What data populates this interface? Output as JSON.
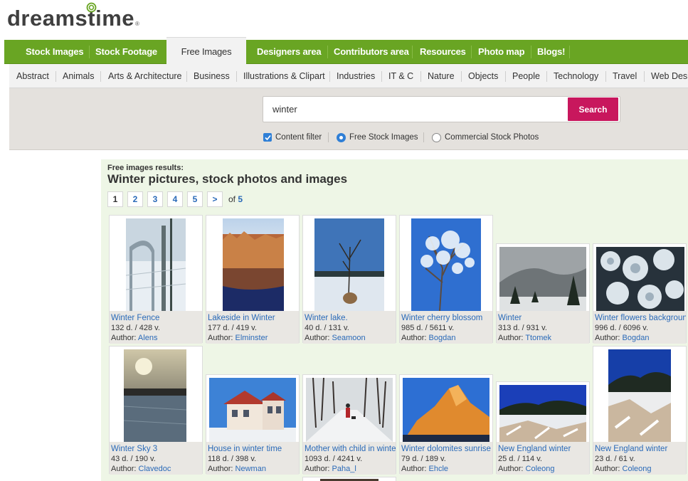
{
  "logo": {
    "text": "dreamstime",
    "reg": "®"
  },
  "main_nav": [
    {
      "label": "Stock Images"
    },
    {
      "label": "Stock Footage"
    },
    {
      "label": "Free Images",
      "active": true
    },
    {
      "label": "Designers area"
    },
    {
      "label": "Contributors area"
    },
    {
      "label": "Resources"
    },
    {
      "label": "Photo map"
    },
    {
      "label": "Blogs!"
    }
  ],
  "categories": [
    "Abstract",
    "Animals",
    "Arts & Architecture",
    "Business",
    "Illustrations & Clipart",
    "Industries",
    "IT & C",
    "Nature",
    "Objects",
    "People",
    "Technology",
    "Travel",
    "Web Design"
  ],
  "search": {
    "value": "winter",
    "button": "Search",
    "content_filter": "Content filter",
    "free_label": "Free Stock Images",
    "commercial_label": "Commercial Stock Photos"
  },
  "results": {
    "pre": "Free images results:",
    "title": "Winter pictures, stock photos and images",
    "pages": [
      "1",
      "2",
      "3",
      "4",
      "5",
      ">"
    ],
    "of_label": "of",
    "total_pages": "5"
  },
  "author_label": "Author:",
  "colors": {
    "brand_green": "#69a523",
    "search_button": "#c8175d",
    "link_blue": "#2a6ab8",
    "results_bg": "#eef6e6"
  },
  "images": [
    {
      "title": "Winter Fence",
      "stats": "132 d. / 428 v.",
      "author": "Alens",
      "icon": "winter-fence-photo"
    },
    {
      "title": "Lakeside in Winter",
      "stats": "177 d. / 419 v.",
      "author": "Elminster",
      "icon": "lakeside-photo"
    },
    {
      "title": "Winter lake.",
      "stats": "40 d. / 131 v.",
      "author": "Seamoon",
      "icon": "winter-lake-photo"
    },
    {
      "title": "Winter cherry blossom",
      "stats": "985 d. / 5611 v.",
      "author": "Bogdan",
      "icon": "frosted-tree-photo"
    },
    {
      "title": "Winter",
      "stats": "313 d. / 931 v.",
      "author": "Ttomek",
      "icon": "misty-mountain-photo"
    },
    {
      "title": "Winter flowers background",
      "stats": "996 d. / 6096 v.",
      "author": "Bogdan",
      "icon": "frost-flowers-photo"
    },
    {
      "title": "Winter Sky 3",
      "stats": "43 d. / 190 v.",
      "author": "Clavedoc",
      "icon": "winter-sky-photo"
    },
    {
      "title": "House in winter time",
      "stats": "118 d. / 398 v.",
      "author": "Newman",
      "icon": "house-photo"
    },
    {
      "title": "Mother with child in winter",
      "stats": "1093 d. / 4241 v.",
      "author": "Paha_l",
      "icon": "mother-child-photo"
    },
    {
      "title": "Winter dolomites sunrise",
      "stats": "79 d. / 189 v.",
      "author": "Ehcle",
      "icon": "dolomites-photo"
    },
    {
      "title": "New England winter",
      "stats": "25 d. / 114 v.",
      "author": "Coleong",
      "icon": "new-england-photo"
    },
    {
      "title": "New England winter",
      "stats": "23 d. / 61 v.",
      "author": "Coleong",
      "icon": "new-england-photo-2"
    }
  ]
}
